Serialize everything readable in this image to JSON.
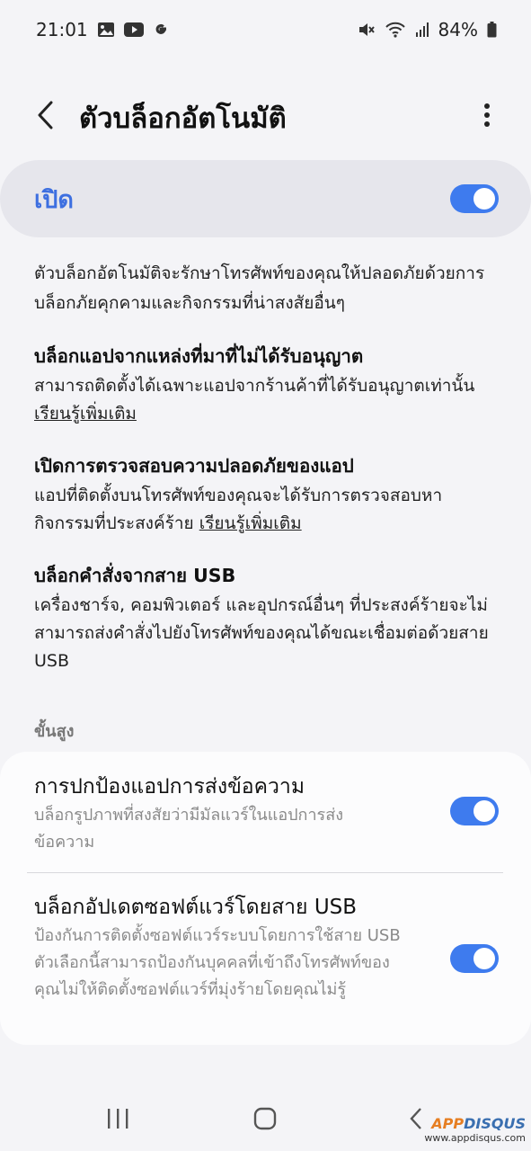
{
  "status_bar": {
    "time": "21:01",
    "left_icons": [
      "image-icon",
      "youtube-icon",
      "google-icon"
    ],
    "right_icons": [
      "mute-icon",
      "wifi-icon",
      "signal-icon",
      "battery-icon"
    ],
    "battery": "84%"
  },
  "header": {
    "title": "ตัวบล็อกอัตโนมัติ"
  },
  "master": {
    "label": "เปิด",
    "enabled": true
  },
  "description": {
    "intro": "ตัวบล็อกอัตโนมัติจะรักษาโทรศัพท์ของคุณให้ปลอดภัยด้วยการบล็อกภัยคุกคามและกิจกรรมที่น่าสงสัยอื่นๆ",
    "features": [
      {
        "title": "บล็อกแอปจากแหล่งที่มาที่ไม่ได้รับอนุญาต",
        "desc": "สามารถติดตั้งได้เฉพาะแอปจากร้านค้าที่ได้รับอนุญาตเท่านั้น",
        "link": "เรียนรู้เพิ่มเติม"
      },
      {
        "title": "เปิดการตรวจสอบความปลอดภัยของแอป",
        "desc": "แอปที่ติดตั้งบนโทรศัพท์ของคุณจะได้รับการตรวจสอบหากิจกรรมที่ประสงค์ร้าย",
        "link": "เรียนรู้เพิ่มเติม"
      },
      {
        "title": "บล็อกคำสั่งจากสาย USB",
        "desc": "เครื่องชาร์จ, คอมพิวเตอร์ และอุปกรณ์อื่นๆ ที่ประสงค์ร้ายจะไม่สามารถส่งคำสั่งไปยังโทรศัพท์ของคุณได้ขณะเชื่อมต่อด้วยสาย USB",
        "link": ""
      }
    ]
  },
  "advanced": {
    "header": "ขั้นสูง",
    "items": [
      {
        "title": "การปกป้องแอปการส่งข้อความ",
        "subtitle": "บล็อกรูปภาพที่สงสัยว่ามีมัลแวร์ในแอปการส่งข้อความ",
        "enabled": true
      },
      {
        "title": "บล็อกอัปเดตซอฟต์แวร์โดยสาย USB",
        "subtitle": "ป้องกันการติดตั้งซอฟต์แวร์ระบบโดยการใช้สาย USB ตัวเลือกนี้สามารถป้องกันบุคคลที่เข้าถึงโทรศัพท์ของคุณไม่ให้ติดตั้งซอฟต์แวร์ที่มุ่งร้ายโดยคุณไม่รู้",
        "enabled": true
      }
    ]
  },
  "nav_bar": {
    "icons": [
      "recents-icon",
      "home-icon",
      "back-icon"
    ]
  },
  "watermark": {
    "logo_app": "APP",
    "logo_disqus": "DISQUS",
    "url": "www.appdisqus.com"
  },
  "colors": {
    "accent": "#3e7bee",
    "master_label": "#3d6fe0",
    "background": "#f4f4f7"
  }
}
